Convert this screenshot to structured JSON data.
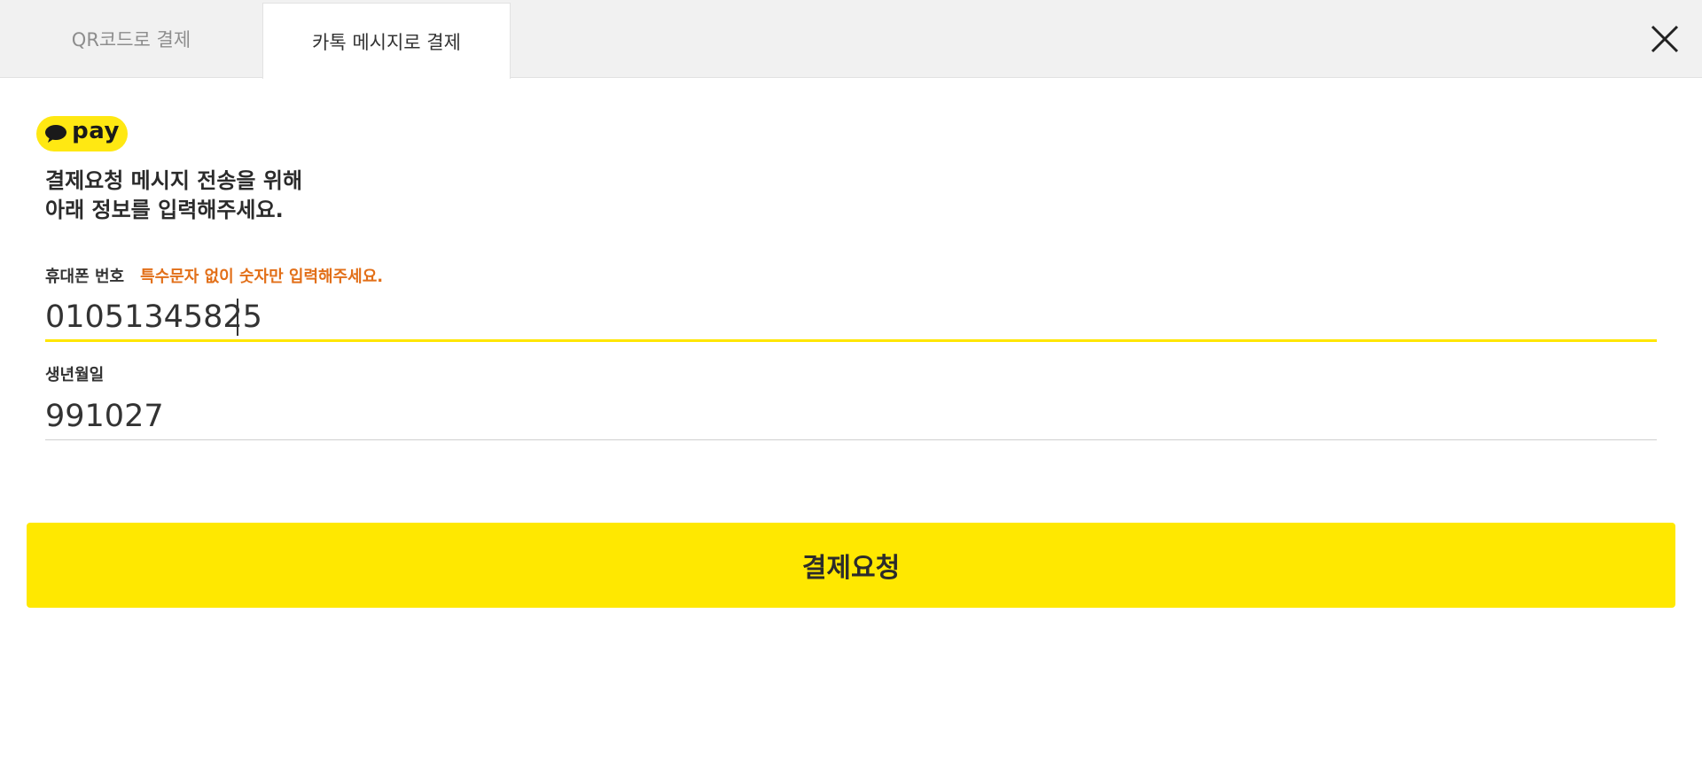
{
  "tabs": [
    {
      "label": "QR코드로 결제",
      "active": false
    },
    {
      "label": "카톡 메시지로 결제",
      "active": true
    }
  ],
  "close_icon": "close-icon",
  "logo": {
    "text": "pay",
    "icon": "speech-bubble-icon",
    "color": "#ffe812"
  },
  "heading": {
    "line1": "결제요청 메시지 전송을 위해",
    "line2": "아래 정보를 입력해주세요."
  },
  "phone": {
    "label": "휴대폰 번호",
    "hint": "특수문자 없이 숫자만 입력해주세요.",
    "value": "01051345825"
  },
  "birth": {
    "label": "생년월일",
    "value": "991027"
  },
  "submit": {
    "label": "결제요청"
  },
  "colors": {
    "accent": "#ffe800",
    "hint": "#e26f18",
    "tab_bar": "#f1f1f1"
  }
}
